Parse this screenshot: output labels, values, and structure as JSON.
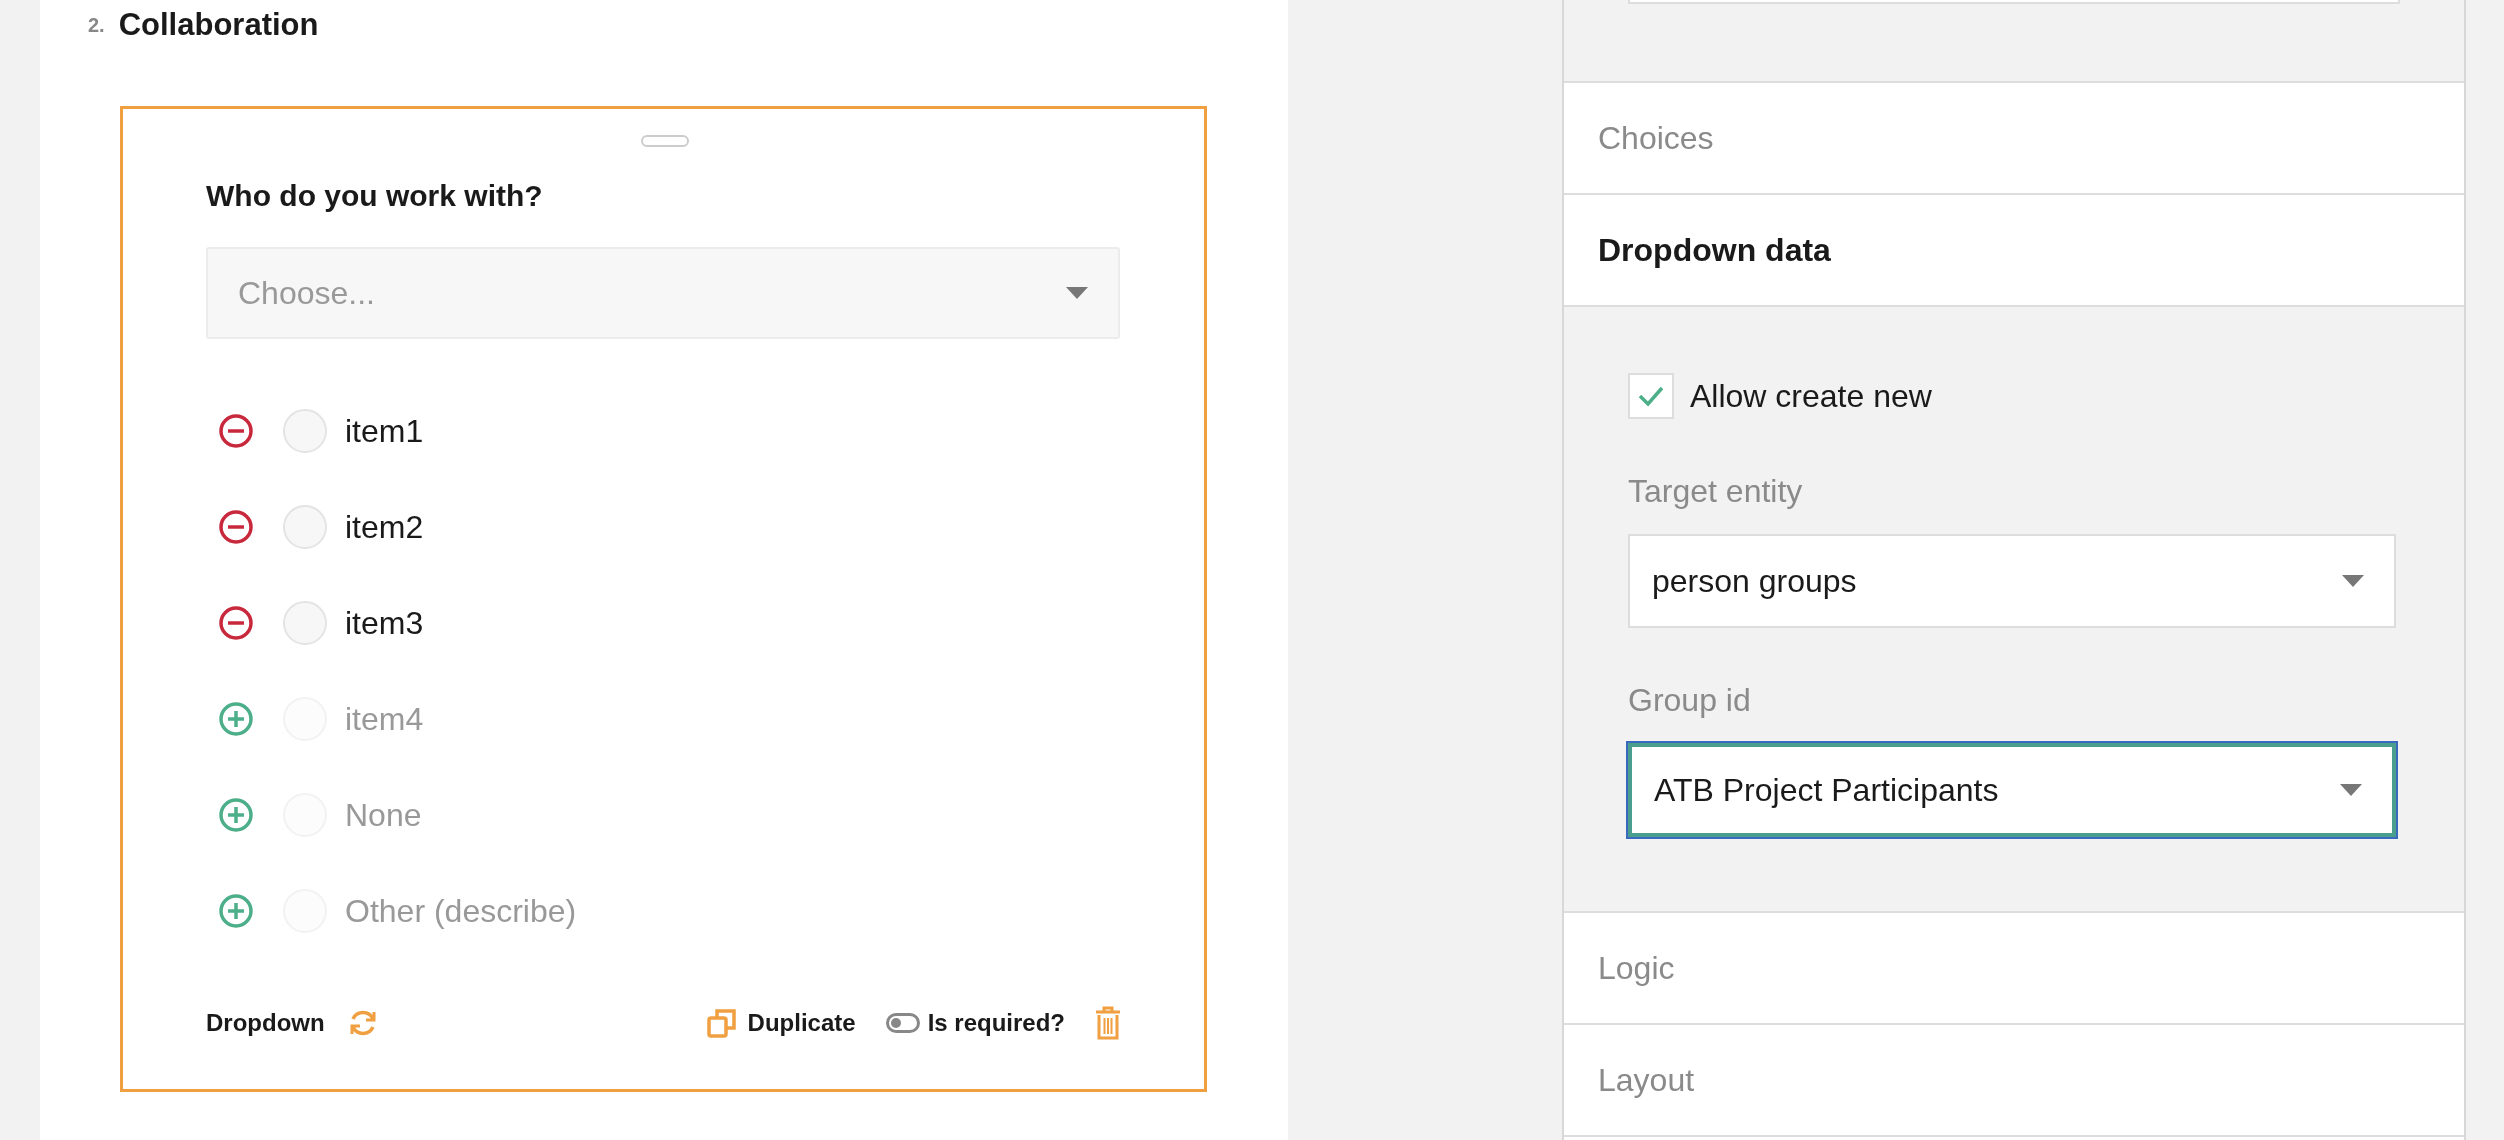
{
  "section": {
    "number": "2.",
    "title": "Collaboration"
  },
  "question": {
    "title": "Who do you work with?",
    "dropdown": {
      "placeholder": "Choose..."
    },
    "choices": [
      {
        "label": "item1",
        "kind": "remove",
        "selected": false
      },
      {
        "label": "item2",
        "kind": "remove",
        "selected": false
      },
      {
        "label": "item3",
        "kind": "remove",
        "selected": false
      },
      {
        "label": "item4",
        "kind": "add",
        "selected": false
      },
      {
        "label": "None",
        "kind": "add",
        "selected": false
      },
      {
        "label": "Other (describe)",
        "kind": "add",
        "selected": false
      }
    ],
    "footer": {
      "type": "Dropdown",
      "duplicate": "Duplicate",
      "required": {
        "label": "Is required?",
        "on": false
      }
    }
  },
  "properties": {
    "sections": [
      {
        "title": "Choices",
        "expanded": false
      },
      {
        "title": "Dropdown data",
        "expanded": true,
        "checkbox": {
          "label": "Allow create new",
          "checked": true
        },
        "fields": [
          {
            "label": "Target entity",
            "value": "person groups",
            "focused": false
          },
          {
            "label": "Group id",
            "value": "ATB Project Participants",
            "focused": true
          }
        ]
      },
      {
        "title": "Logic",
        "expanded": false
      },
      {
        "title": "Layout",
        "expanded": false
      }
    ]
  }
}
